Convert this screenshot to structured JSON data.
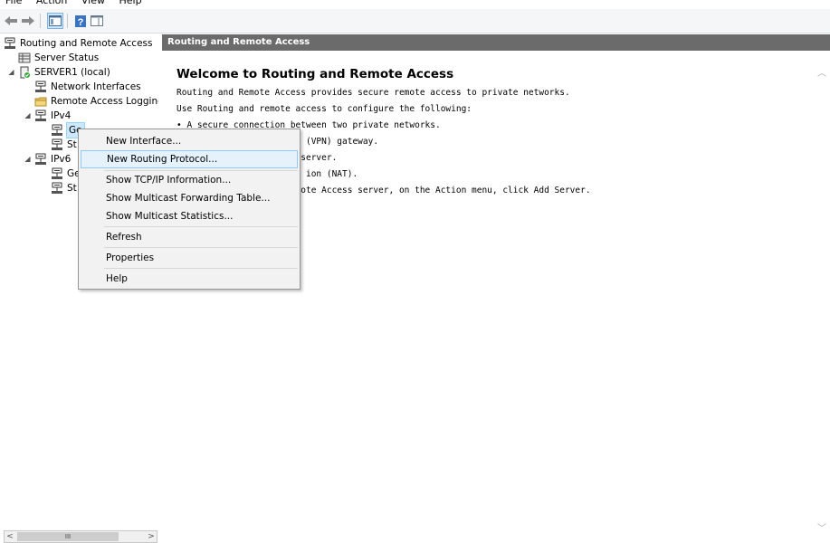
{
  "menubar": {
    "file": "File",
    "action": "Action",
    "view": "View",
    "help": "Help"
  },
  "tree": {
    "root": "Routing and Remote Access",
    "server_status": "Server Status",
    "server": "SERVER1 (local)",
    "network_interfaces": "Network Interfaces",
    "remote_access_logging": "Remote Access Logging",
    "ipv4": "IPv4",
    "ipv4_general": "Ge",
    "ipv4_static": "St",
    "ipv6": "IPv6",
    "ipv6_general": "Ge",
    "ipv6_static": "St",
    "scroll_thumb": "III"
  },
  "right": {
    "header": "Routing and Remote Access",
    "title": "Welcome to Routing and Remote Access",
    "lines": [
      "Routing and Remote Access provides secure remote access to private networks.",
      "Use Routing and remote access to configure the following:",
      "• A secure connection between two private networks.",
      "                         (VPN) gateway.",
      "                        server.",
      "                         ion (NAT).",
      "",
      "",
      "                        ote Access server, on the Action menu, click Add Server."
    ]
  },
  "context_menu": {
    "new_interface": "New Interface...",
    "new_routing_protocol": "New Routing Protocol...",
    "show_tcpip": "Show TCP/IP Information...",
    "show_multicast_forwarding": "Show Multicast Forwarding Table...",
    "show_multicast_stats": "Show Multicast Statistics...",
    "refresh": "Refresh",
    "properties": "Properties",
    "help": "Help"
  }
}
